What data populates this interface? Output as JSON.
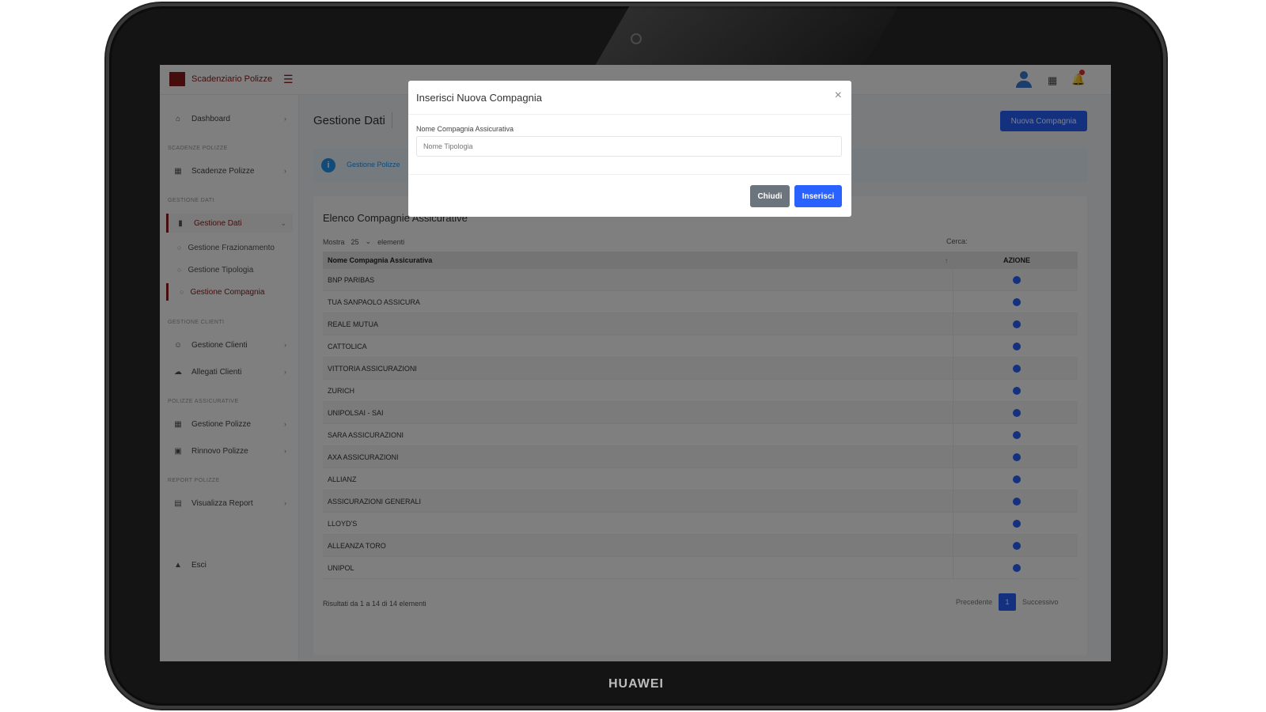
{
  "device": {
    "brand": "HUAWEI"
  },
  "app": {
    "title": "Scadenziario Polizze"
  },
  "sidebar": {
    "items": [
      {
        "label": "Dashboard",
        "icon": "home-icon"
      },
      {
        "section": "SCADENZE POLIZZE"
      },
      {
        "label": "Scadenze Polizze",
        "icon": "calendar-icon"
      },
      {
        "section": "GESTIONE DATI"
      },
      {
        "label": "Gestione Dati",
        "icon": "database-icon",
        "active": true
      },
      {
        "sub": "Gestione Frazionamento"
      },
      {
        "sub": "Gestione Tipologia"
      },
      {
        "sub": "Gestione Compagnia",
        "active": true
      },
      {
        "section": "GESTIONE CLIENTI"
      },
      {
        "label": "Gestione Clienti",
        "icon": "user-icon"
      },
      {
        "label": "Allegati Clienti",
        "icon": "paperclip-icon"
      },
      {
        "section": "POLIZZE ASSICURATIVE"
      },
      {
        "label": "Gestione Polizze",
        "icon": "file-icon"
      },
      {
        "label": "Rinnovo Polizze",
        "icon": "refresh-icon"
      },
      {
        "section": "REPORT POLIZZE"
      },
      {
        "label": "Visualizza Report",
        "icon": "report-icon"
      },
      {
        "label": "Esci",
        "icon": "lock-icon"
      }
    ]
  },
  "header": {
    "page_title": "Gestione Dati",
    "new_button": "Nuova Compagnia"
  },
  "info": {
    "text": "Gestione Polizze"
  },
  "table": {
    "title": "Elenco Compagnie Assicurative",
    "show_label": "Mostra",
    "show_value": "25",
    "elements_label": "elementi",
    "search_label": "Cerca:",
    "columns": [
      "Nome Compagnia Assicurativa",
      "AZIONE"
    ],
    "rows": [
      "BNP PARIBAS",
      "TUA SANPAOLO ASSICURA",
      "REALE MUTUA",
      "CATTOLICA",
      "VITTORIA ASSICURAZIONI",
      "ZURICH",
      "UNIPOLSAI - SAI",
      "SARA ASSICURAZIONI",
      "AXA ASSICURAZIONI",
      "ALLIANZ",
      "ASSICURAZIONI GENERALI",
      "LLOYD'S",
      "ALLEANZA TORO",
      "UNIPOL"
    ],
    "footer": "Risultati da 1 a 14 di 14 elementi",
    "prev": "Precedente",
    "page": "1",
    "next": "Successivo"
  },
  "modal": {
    "title": "Inserisci Nuova Compagnia",
    "field_label": "Nome Compagnia Assicurativa",
    "placeholder": "Nome Tipologia",
    "close_label": "Chiudi",
    "insert_label": "Inserisci"
  },
  "colors": {
    "primary": "#2962ff",
    "brand": "#8b1b1b",
    "secondary": "#6c757d"
  }
}
